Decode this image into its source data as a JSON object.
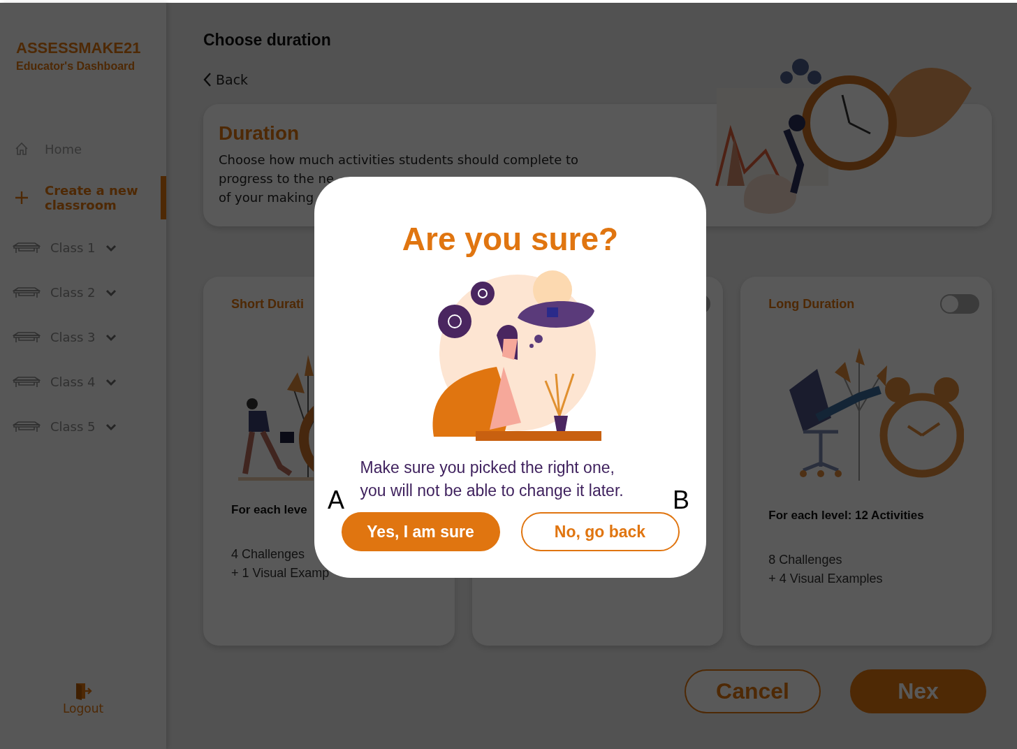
{
  "sidebar": {
    "brand": "ASSESSMAKE21",
    "subtitle": "Educator's Dashboard",
    "nav": [
      {
        "kind": "home",
        "label": "Home",
        "selected": false
      },
      {
        "kind": "create",
        "label": "Create a new classroom",
        "selected": true
      }
    ],
    "classes": [
      {
        "label": "Class 1",
        "expanded": false
      },
      {
        "label": "Class 2",
        "expanded": false
      },
      {
        "label": "Class 3",
        "expanded": false
      },
      {
        "label": "Class 4",
        "expanded": false
      },
      {
        "label": "Class 5",
        "expanded": false
      }
    ],
    "logout": "Logout"
  },
  "main": {
    "title": "Choose duration",
    "back": "Back",
    "intro": {
      "title": "Duration",
      "lines": [
        "Choose how much activities students should complete to",
        "progress to the ne",
        "of your making"
      ]
    },
    "options": [
      {
        "kind": "short",
        "title": "Short Durati",
        "summary": "For each leve",
        "details": [
          "4 Challenges",
          "+ 1 Visual Examp"
        ]
      },
      {
        "kind": "medium",
        "toggle_on": false
      },
      {
        "kind": "long",
        "title": "Long Duration",
        "toggle_on": false,
        "summary": "For each level: 12 Activities",
        "details": [
          "8 Challenges",
          "+ 4 Visual Examples"
        ]
      }
    ],
    "buttons": [
      {
        "kind": "outline",
        "label": "Cancel"
      },
      {
        "kind": "filled",
        "label": "Nex"
      }
    ]
  },
  "dialog": {
    "title": "Are you sure?",
    "message": [
      "Make sure you picked the right one,",
      "you will not be able to change it later."
    ],
    "buttons": [
      {
        "kind": "filled",
        "label": "Yes, I am sure"
      },
      {
        "kind": "outline",
        "label": "No, go back"
      }
    ]
  },
  "annotations": [
    {
      "label": "A"
    },
    {
      "label": "B"
    }
  ]
}
